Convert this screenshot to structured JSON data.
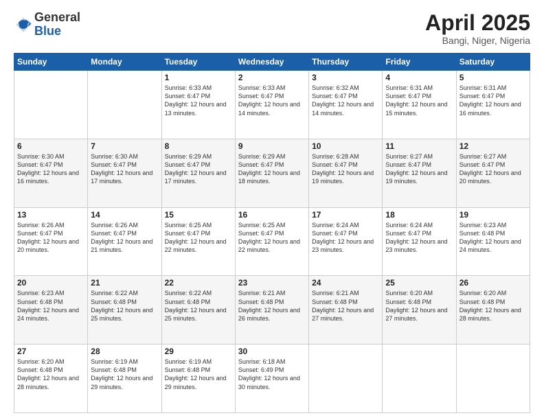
{
  "logo": {
    "general": "General",
    "blue": "Blue"
  },
  "header": {
    "month": "April 2025",
    "location": "Bangi, Niger, Nigeria"
  },
  "weekdays": [
    "Sunday",
    "Monday",
    "Tuesday",
    "Wednesday",
    "Thursday",
    "Friday",
    "Saturday"
  ],
  "weeks": [
    [
      {
        "day": "",
        "info": ""
      },
      {
        "day": "",
        "info": ""
      },
      {
        "day": "1",
        "info": "Sunrise: 6:33 AM\nSunset: 6:47 PM\nDaylight: 12 hours and 13 minutes."
      },
      {
        "day": "2",
        "info": "Sunrise: 6:33 AM\nSunset: 6:47 PM\nDaylight: 12 hours and 14 minutes."
      },
      {
        "day": "3",
        "info": "Sunrise: 6:32 AM\nSunset: 6:47 PM\nDaylight: 12 hours and 14 minutes."
      },
      {
        "day": "4",
        "info": "Sunrise: 6:31 AM\nSunset: 6:47 PM\nDaylight: 12 hours and 15 minutes."
      },
      {
        "day": "5",
        "info": "Sunrise: 6:31 AM\nSunset: 6:47 PM\nDaylight: 12 hours and 16 minutes."
      }
    ],
    [
      {
        "day": "6",
        "info": "Sunrise: 6:30 AM\nSunset: 6:47 PM\nDaylight: 12 hours and 16 minutes."
      },
      {
        "day": "7",
        "info": "Sunrise: 6:30 AM\nSunset: 6:47 PM\nDaylight: 12 hours and 17 minutes."
      },
      {
        "day": "8",
        "info": "Sunrise: 6:29 AM\nSunset: 6:47 PM\nDaylight: 12 hours and 17 minutes."
      },
      {
        "day": "9",
        "info": "Sunrise: 6:29 AM\nSunset: 6:47 PM\nDaylight: 12 hours and 18 minutes."
      },
      {
        "day": "10",
        "info": "Sunrise: 6:28 AM\nSunset: 6:47 PM\nDaylight: 12 hours and 19 minutes."
      },
      {
        "day": "11",
        "info": "Sunrise: 6:27 AM\nSunset: 6:47 PM\nDaylight: 12 hours and 19 minutes."
      },
      {
        "day": "12",
        "info": "Sunrise: 6:27 AM\nSunset: 6:47 PM\nDaylight: 12 hours and 20 minutes."
      }
    ],
    [
      {
        "day": "13",
        "info": "Sunrise: 6:26 AM\nSunset: 6:47 PM\nDaylight: 12 hours and 20 minutes."
      },
      {
        "day": "14",
        "info": "Sunrise: 6:26 AM\nSunset: 6:47 PM\nDaylight: 12 hours and 21 minutes."
      },
      {
        "day": "15",
        "info": "Sunrise: 6:25 AM\nSunset: 6:47 PM\nDaylight: 12 hours and 22 minutes."
      },
      {
        "day": "16",
        "info": "Sunrise: 6:25 AM\nSunset: 6:47 PM\nDaylight: 12 hours and 22 minutes."
      },
      {
        "day": "17",
        "info": "Sunrise: 6:24 AM\nSunset: 6:47 PM\nDaylight: 12 hours and 23 minutes."
      },
      {
        "day": "18",
        "info": "Sunrise: 6:24 AM\nSunset: 6:47 PM\nDaylight: 12 hours and 23 minutes."
      },
      {
        "day": "19",
        "info": "Sunrise: 6:23 AM\nSunset: 6:48 PM\nDaylight: 12 hours and 24 minutes."
      }
    ],
    [
      {
        "day": "20",
        "info": "Sunrise: 6:23 AM\nSunset: 6:48 PM\nDaylight: 12 hours and 24 minutes."
      },
      {
        "day": "21",
        "info": "Sunrise: 6:22 AM\nSunset: 6:48 PM\nDaylight: 12 hours and 25 minutes."
      },
      {
        "day": "22",
        "info": "Sunrise: 6:22 AM\nSunset: 6:48 PM\nDaylight: 12 hours and 25 minutes."
      },
      {
        "day": "23",
        "info": "Sunrise: 6:21 AM\nSunset: 6:48 PM\nDaylight: 12 hours and 26 minutes."
      },
      {
        "day": "24",
        "info": "Sunrise: 6:21 AM\nSunset: 6:48 PM\nDaylight: 12 hours and 27 minutes."
      },
      {
        "day": "25",
        "info": "Sunrise: 6:20 AM\nSunset: 6:48 PM\nDaylight: 12 hours and 27 minutes."
      },
      {
        "day": "26",
        "info": "Sunrise: 6:20 AM\nSunset: 6:48 PM\nDaylight: 12 hours and 28 minutes."
      }
    ],
    [
      {
        "day": "27",
        "info": "Sunrise: 6:20 AM\nSunset: 6:48 PM\nDaylight: 12 hours and 28 minutes."
      },
      {
        "day": "28",
        "info": "Sunrise: 6:19 AM\nSunset: 6:48 PM\nDaylight: 12 hours and 29 minutes."
      },
      {
        "day": "29",
        "info": "Sunrise: 6:19 AM\nSunset: 6:48 PM\nDaylight: 12 hours and 29 minutes."
      },
      {
        "day": "30",
        "info": "Sunrise: 6:18 AM\nSunset: 6:49 PM\nDaylight: 12 hours and 30 minutes."
      },
      {
        "day": "",
        "info": ""
      },
      {
        "day": "",
        "info": ""
      },
      {
        "day": "",
        "info": ""
      }
    ]
  ]
}
